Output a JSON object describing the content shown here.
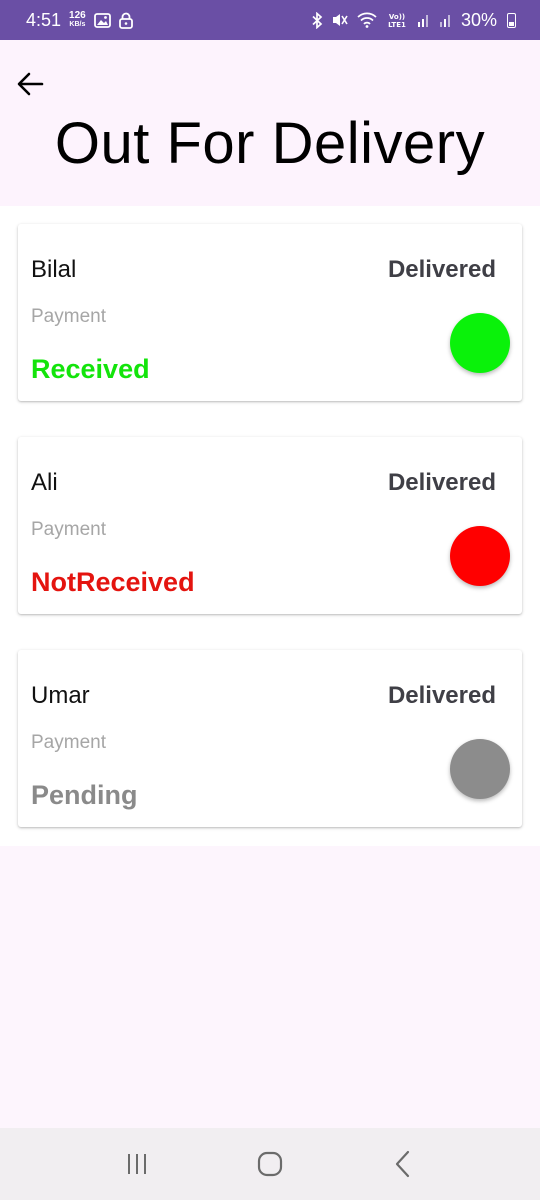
{
  "status_bar": {
    "time": "4:51",
    "speed_value": "126",
    "speed_unit": "KB/s",
    "battery": "30%"
  },
  "header": {
    "title": "Out For Delivery"
  },
  "orders": [
    {
      "name": "Bilal",
      "status": "Delivered",
      "payment_label": "Payment",
      "payment_status": "Received",
      "payment_color": "#13e40b",
      "dot_color": "#0af20a"
    },
    {
      "name": "Ali",
      "status": "Delivered",
      "payment_label": "Payment",
      "payment_status": "NotReceived",
      "payment_color": "#e4140f",
      "dot_color": "#ff0000"
    },
    {
      "name": "Umar",
      "status": "Delivered",
      "payment_label": "Payment",
      "payment_status": "Pending",
      "payment_color": "#8a8a8a",
      "dot_color": "#8c8c8c"
    }
  ],
  "icons": {
    "back": "arrow-left-icon",
    "nav_recents": "recents-icon",
    "nav_home": "home-icon",
    "nav_back": "chevron-left-icon"
  },
  "colors": {
    "status_bar": "#6a4fa5",
    "header_bg": "#fdf3fd"
  }
}
